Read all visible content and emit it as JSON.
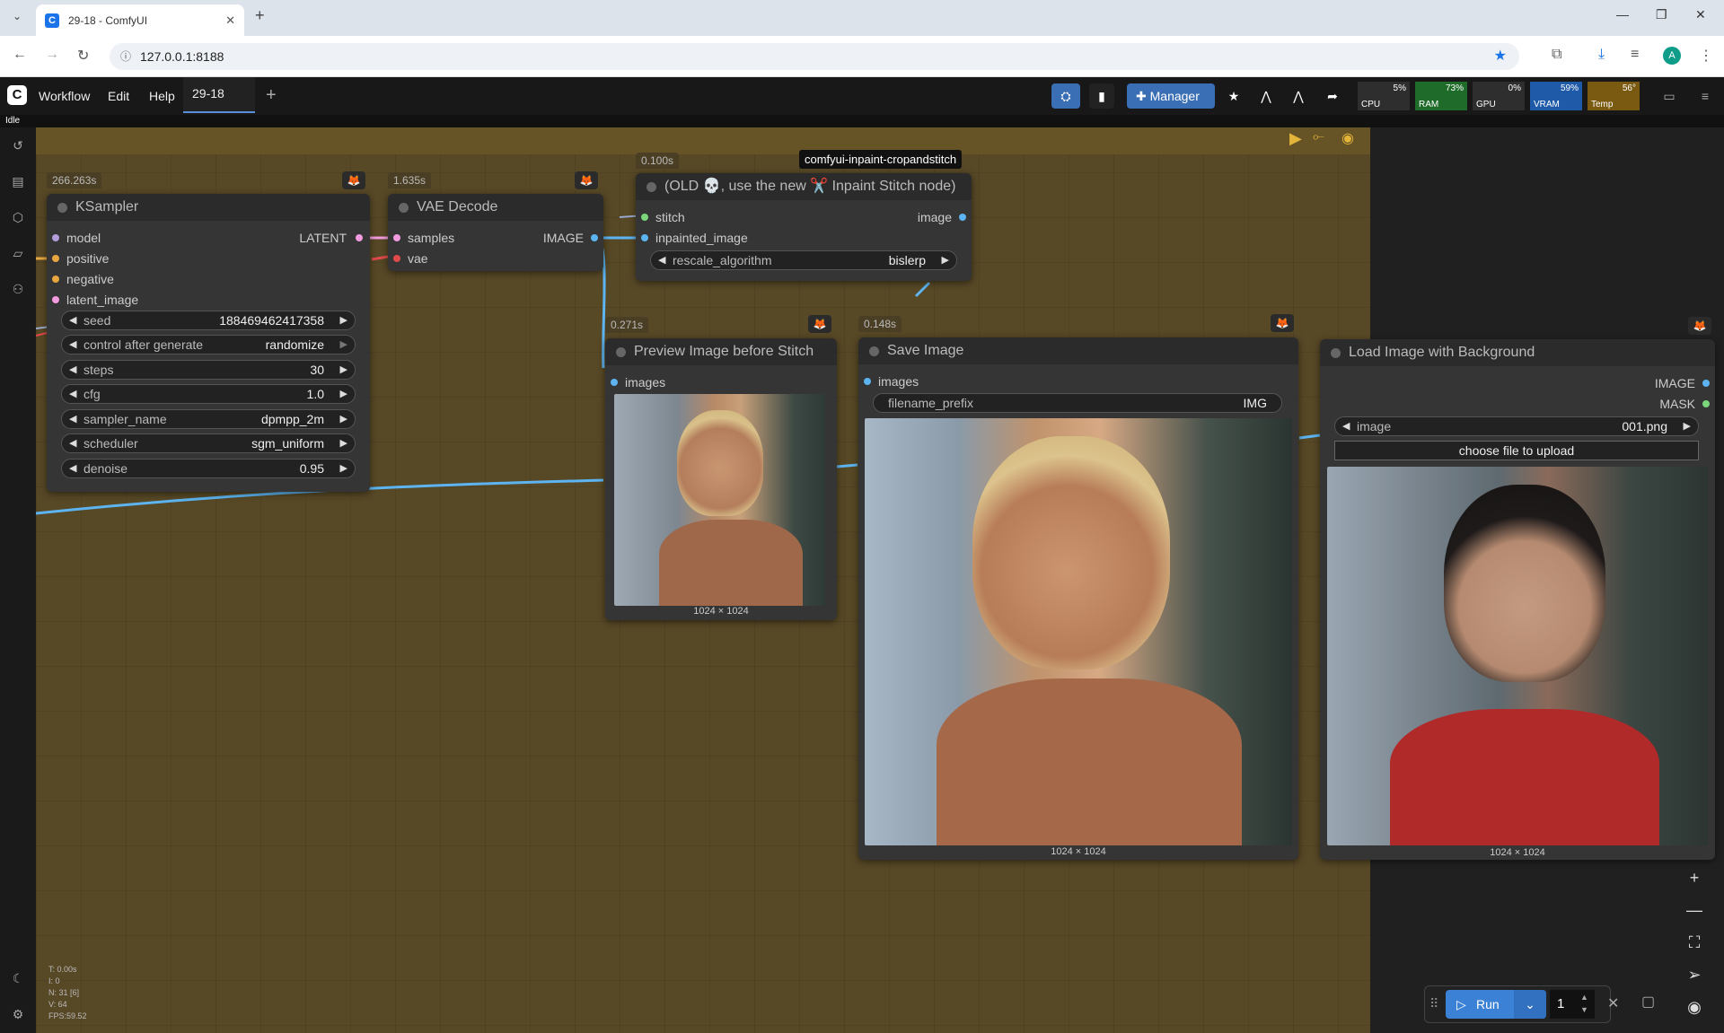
{
  "browser": {
    "tab_title": "29-18 - ComfyUI",
    "url": "127.0.0.1:8188"
  },
  "menu": {
    "items": [
      "Workflow",
      "Edit",
      "Help"
    ],
    "workflow_tab": "29-18",
    "manager_label": "Manager",
    "status": "Idle"
  },
  "monitors": [
    {
      "label": "CPU",
      "value": "5%",
      "color": "#2e2e2e"
    },
    {
      "label": "RAM",
      "value": "73%",
      "color": "#1e6b2a"
    },
    {
      "label": "GPU",
      "value": "0%",
      "color": "#2e2e2e"
    },
    {
      "label": "VRAM",
      "value": "59%",
      "color": "#1f5aa8"
    },
    {
      "label": "Temp",
      "value": "56°",
      "color": "#7a5a10"
    }
  ],
  "nodes": {
    "ksampler": {
      "timing": "266.263s",
      "title": "KSampler",
      "inputs": [
        "model",
        "positive",
        "negative",
        "latent_image"
      ],
      "output": "LATENT",
      "widgets": [
        {
          "label": "seed",
          "value": "188469462417358"
        },
        {
          "label": "control after generate",
          "value": "randomize"
        },
        {
          "label": "steps",
          "value": "30"
        },
        {
          "label": "cfg",
          "value": "1.0"
        },
        {
          "label": "sampler_name",
          "value": "dpmpp_2m"
        },
        {
          "label": "scheduler",
          "value": "sgm_uniform"
        },
        {
          "label": "denoise",
          "value": "0.95"
        }
      ]
    },
    "vae_decode": {
      "timing": "1.635s",
      "title": "VAE Decode",
      "inputs": [
        "samples",
        "vae"
      ],
      "output": "IMAGE"
    },
    "stitch": {
      "timing": "0.100s",
      "badge": "comfyui-inpaint-cropandstitch",
      "title": "(OLD 💀, use the new ✂️ Inpaint Stitch node)",
      "inputs": [
        "stitch",
        "inpainted_image"
      ],
      "output": "image",
      "widget": {
        "label": "rescale_algorithm",
        "value": "bislerp"
      }
    },
    "preview": {
      "timing": "0.271s",
      "title": "Preview Image before Stitch",
      "input": "images",
      "dims": "1024 × 1024"
    },
    "save": {
      "timing": "0.148s",
      "title": "Save Image",
      "input": "images",
      "widget": {
        "label": "filename_prefix",
        "value": "IMG"
      },
      "dims": "1024 × 1024"
    },
    "load": {
      "title": "Load Image with Background",
      "outputs": [
        "IMAGE",
        "MASK"
      ],
      "widget": {
        "label": "image",
        "value": "001.png"
      },
      "upload_label": "choose file to upload",
      "dims": "1024 × 1024"
    }
  },
  "stats": [
    "T: 0.00s",
    "I: 0",
    "N: 31 [6]",
    "V: 64",
    "FPS:59.52"
  ],
  "run": {
    "label": "Run",
    "count": "1"
  }
}
